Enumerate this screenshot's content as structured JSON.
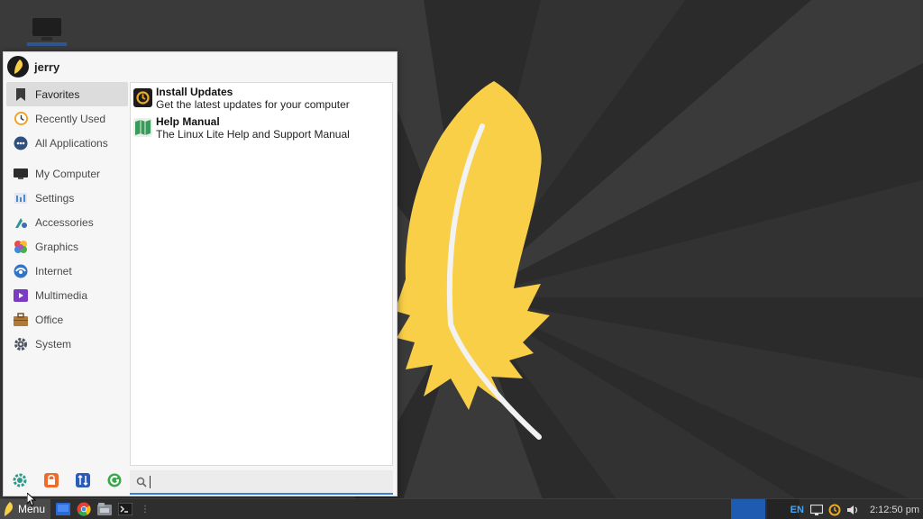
{
  "user": {
    "name": "jerry"
  },
  "categories": [
    {
      "label": "Favorites",
      "icon": "bookmark-icon",
      "active": true
    },
    {
      "label": "Recently Used",
      "icon": "clock-icon"
    },
    {
      "label": "All Applications",
      "icon": "applications-icon"
    },
    {
      "label": "My Computer",
      "icon": "monitor-icon"
    },
    {
      "label": "Settings",
      "icon": "settings-icon"
    },
    {
      "label": "Accessories",
      "icon": "accessories-icon"
    },
    {
      "label": "Graphics",
      "icon": "graphics-icon"
    },
    {
      "label": "Internet",
      "icon": "internet-icon"
    },
    {
      "label": "Multimedia",
      "icon": "multimedia-icon"
    },
    {
      "label": "Office",
      "icon": "briefcase-icon"
    },
    {
      "label": "System",
      "icon": "gear-icon"
    }
  ],
  "favorites": [
    {
      "name": "Install Updates",
      "description": "Get the latest updates for your computer",
      "icon": "updates-icon"
    },
    {
      "name": "Help Manual",
      "description": "The Linux Lite Help and Support Manual",
      "icon": "help-manual-icon"
    }
  ],
  "actions": [
    "settings-manager-icon",
    "lock-screen-icon",
    "switch-user-icon",
    "log-out-icon"
  ],
  "search": {
    "value": "",
    "placeholder": ""
  },
  "taskbar": {
    "menu_label": "Menu",
    "launchers": [
      "show-desktop-icon",
      "chrome-icon",
      "file-manager-icon",
      "terminal-icon"
    ],
    "language": "EN",
    "clock": "2:12:50 pm"
  },
  "colors": {
    "accent": "#3b7ddd",
    "feather": "#f9cf48",
    "workspace_active": "#1f5bb0",
    "taskbar": "#2e2e2e"
  }
}
